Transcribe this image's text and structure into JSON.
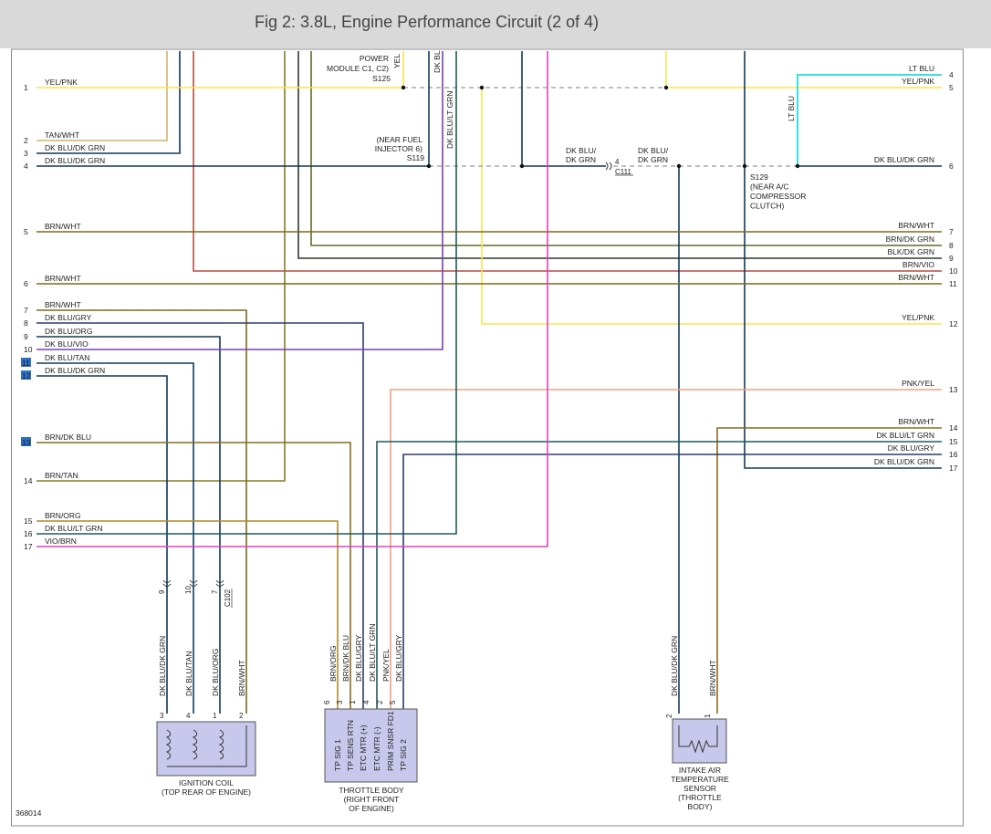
{
  "title": "Fig 2: 3.8L, Engine Performance Circuit (2 of 4)",
  "figure_id": "368014",
  "colors": {
    "YEL": "#ffe24a",
    "TAN": "#d4b06a",
    "DKBLU_DKGRN": "#12385a",
    "BRN": "#7a6a1e",
    "BRN_DKGRN": "#5d6b2a",
    "BLK_DKGRN": "#2c3b2c",
    "BRN_VIO": "#b84a44",
    "DKBLU_GRY": "#2a3d6b",
    "DKBLU_VIO": "#7a40b4",
    "DKBLU_LTGRN": "#1e5a5a",
    "PNK_YEL": "#f0a080",
    "VIO_BRN": "#e040c0",
    "LTBLU": "#38e0e0",
    "BRN_DKBLU": "#8a6a20",
    "BRN_ORG": "#b08a28",
    "BRN_TAN": "#8a7a20",
    "highlight": "#2b6fc5",
    "box": "#c8c8ec"
  },
  "left": [
    {
      "n": "1",
      "label": "YEL/PNK"
    },
    {
      "n": "2",
      "label": "TAN/WHT"
    },
    {
      "n": "3",
      "label": "DK BLU/DK GRN"
    },
    {
      "n": "4",
      "label": "DK BLU/DK GRN"
    },
    {
      "n": "5",
      "label": "BRN/WHT"
    },
    {
      "n": "6",
      "label": "BRN/WHT"
    },
    {
      "n": "7",
      "label": "BRN/WHT"
    },
    {
      "n": "8",
      "label": "DK BLU/GRY"
    },
    {
      "n": "9",
      "label": "DK BLU/ORG"
    },
    {
      "n": "10",
      "label": "DK BLU/VIO"
    },
    {
      "n": "11",
      "label": "DK BLU/TAN"
    },
    {
      "n": "12",
      "label": "DK BLU/DK GRN"
    },
    {
      "n": "13",
      "label": "BRN/DK BLU"
    },
    {
      "n": "14",
      "label": "BRN/TAN"
    },
    {
      "n": "15",
      "label": "BRN/ORG"
    },
    {
      "n": "16",
      "label": "DK BLU/LT GRN"
    },
    {
      "n": "17",
      "label": "VIO/BRN"
    }
  ],
  "right": [
    {
      "n": "4",
      "label": "LT BLU"
    },
    {
      "n": "5",
      "label": "YEL/PNK"
    },
    {
      "n": "6",
      "label": "DK BLU/DK GRN"
    },
    {
      "n": "7",
      "label": "BRN/WHT"
    },
    {
      "n": "8",
      "label": "BRN/DK GRN"
    },
    {
      "n": "9",
      "label": "BLK/DK GRN"
    },
    {
      "n": "10",
      "label": "BRN/VIO"
    },
    {
      "n": "11",
      "label": "BRN/WHT"
    },
    {
      "n": "12",
      "label": "YEL/PNK"
    },
    {
      "n": "13",
      "label": "PNK/YEL"
    },
    {
      "n": "14",
      "label": "BRN/WHT"
    },
    {
      "n": "15",
      "label": "DK BLU/LT GRN"
    },
    {
      "n": "16",
      "label": "DK BLU/GRY"
    },
    {
      "n": "17",
      "label": "DK BLU/DK GRN"
    }
  ],
  "top_wire_labels": {
    "yel": "YEL",
    "dkbl": "DK BL",
    "dkblultgrn": "DK BLU/LT GRN",
    "ltblu": "LT BLU"
  },
  "splices": {
    "s125": {
      "lines": [
        "POWER",
        "MODULE C1, C2)"
      ],
      "id": "S125"
    },
    "s119": {
      "lines": [
        "(NEAR FUEL",
        "INJECTOR 6)"
      ],
      "id": "S119"
    },
    "c111": {
      "left": [
        "DK BLU/",
        "DK GRN"
      ],
      "right": [
        "DK BLU/",
        "DK GRN"
      ],
      "pin": "4",
      "id": "C111"
    },
    "s129": {
      "lines": [
        "S129",
        "(NEAR A/C",
        "COMPRESSOR",
        "CLUTCH)"
      ]
    }
  },
  "c102": {
    "id": "C102",
    "pins": [
      "9",
      "10",
      "7"
    ]
  },
  "ignition_coil": {
    "wires": [
      "DK BLU/DK GRN",
      "DK BLU/TAN",
      "DK BLU/ORG",
      "BRN/WHT"
    ],
    "pins": [
      "3",
      "4",
      "1",
      "2"
    ],
    "name": [
      "IGNITION COIL",
      "(TOP REAR OF ENGINE)"
    ]
  },
  "throttle_body": {
    "wires": [
      "BRN/ORG",
      "BRN/DK BLU",
      "DK BLU/GRY",
      "DK BLU/LT GRN",
      "PNK/YEL",
      "DK BLU/GRY"
    ],
    "pins": [
      "6",
      "3",
      "1",
      "4",
      "2",
      "5"
    ],
    "internal": [
      "TP SIG 1",
      "TP SENS RTN",
      "ETC MTR (+)",
      "ETC MTR (-)",
      "PRIM SNSR FD1",
      "TP SIG 2"
    ],
    "name": [
      "THROTTLE BODY",
      "(RIGHT FRONT",
      "OF ENGINE)"
    ]
  },
  "iat_sensor": {
    "wires": [
      "DK BLU/DK GRN",
      "BRN/WHT"
    ],
    "pins": [
      "2",
      "1"
    ],
    "name": [
      "INTAKE AIR",
      "TEMPERATURE",
      "SENSOR",
      "(THROTTLE",
      "BODY)"
    ]
  }
}
